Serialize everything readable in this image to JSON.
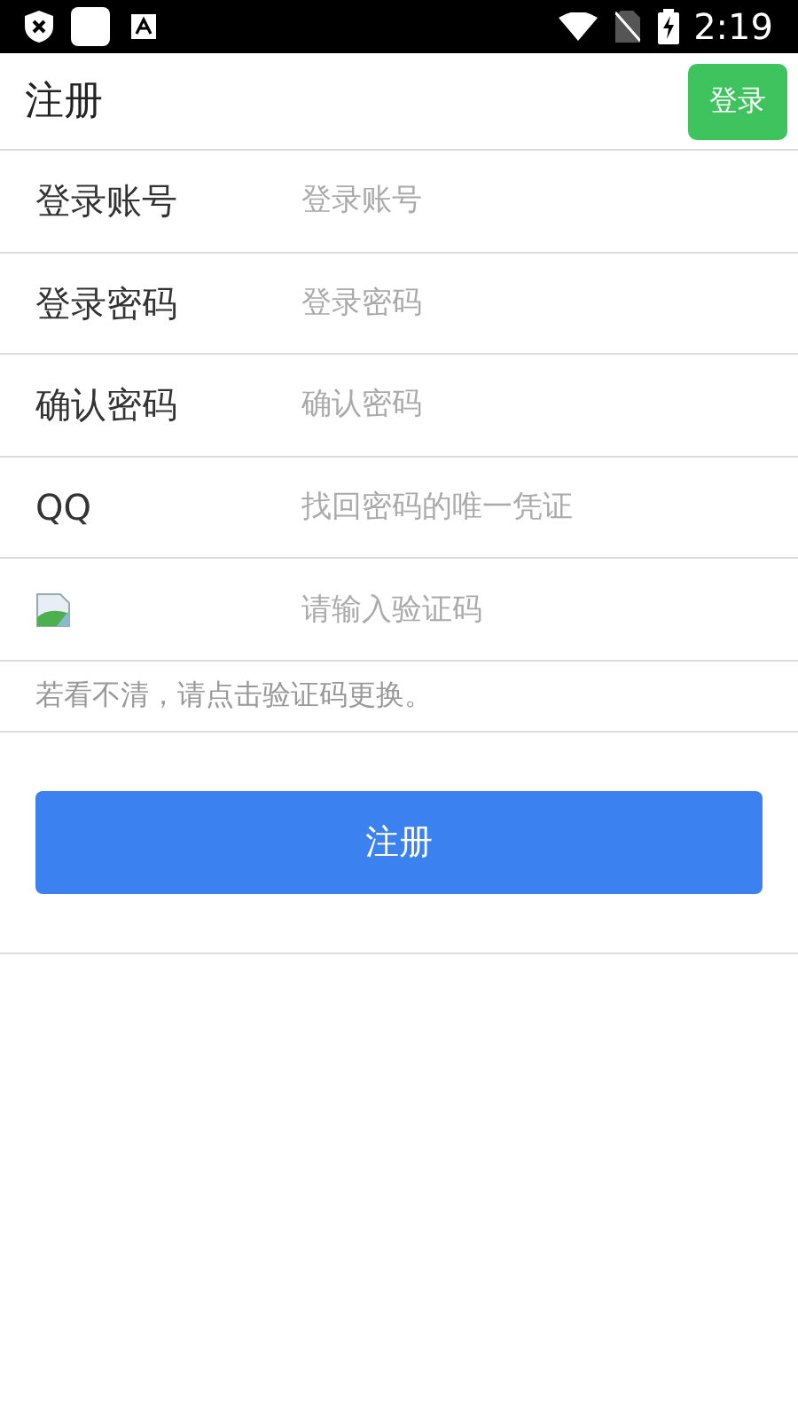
{
  "status_bar": {
    "time": "2:19"
  },
  "header": {
    "title": "注册",
    "login_button": "登录"
  },
  "fields": [
    {
      "kind": "text",
      "label": "登录账号",
      "placeholder": "登录账号"
    },
    {
      "kind": "text",
      "label": "登录密码",
      "placeholder": "登录密码"
    },
    {
      "kind": "text",
      "label": "确认密码",
      "placeholder": "确认密码"
    },
    {
      "kind": "text",
      "label": "QQ",
      "placeholder": "找回密码的唯一凭证"
    },
    {
      "kind": "captcha",
      "placeholder": "请输入验证码"
    }
  ],
  "hint": "若看不清，请点击验证码更换。",
  "submit_button": "注册"
}
